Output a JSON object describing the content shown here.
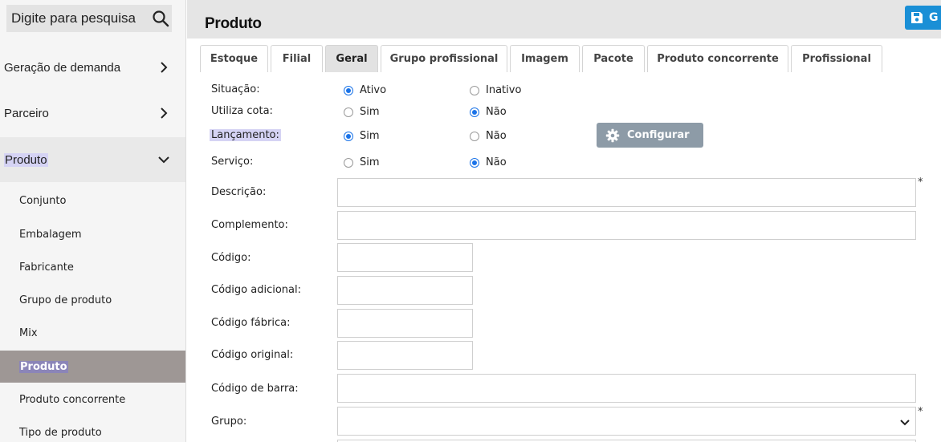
{
  "sidebar": {
    "search": {
      "placeholder": "Digite para pesquisa"
    },
    "groups": [
      {
        "label": "Geração de demanda"
      },
      {
        "label": "Parceiro"
      },
      {
        "label": "Produto"
      }
    ],
    "sub_items": [
      {
        "label": "Conjunto"
      },
      {
        "label": "Embalagem"
      },
      {
        "label": "Fabricante"
      },
      {
        "label": "Grupo de produto"
      },
      {
        "label": "Mix"
      },
      {
        "label": "Produto"
      },
      {
        "label": "Produto concorrente"
      },
      {
        "label": "Tipo de produto"
      }
    ]
  },
  "header": {
    "title": "Produto",
    "save_label": "G"
  },
  "tabs": [
    {
      "label": "Estoque"
    },
    {
      "label": "Filial"
    },
    {
      "label": "Geral"
    },
    {
      "label": "Grupo profissional"
    },
    {
      "label": "Imagem"
    },
    {
      "label": "Pacote"
    },
    {
      "label": "Produto concorrente"
    },
    {
      "label": "Profissional"
    }
  ],
  "form": {
    "situacao": {
      "label": "Situação:",
      "opt1": "Ativo",
      "opt2": "Inativo",
      "selected": "Ativo"
    },
    "utiliza_cota": {
      "label": "Utiliza cota:",
      "opt1": "Sim",
      "opt2": "Não",
      "selected": "Não"
    },
    "lancamento": {
      "label": "Lançamento:",
      "opt1": "Sim",
      "opt2": "Não",
      "selected": "Sim"
    },
    "servico": {
      "label": "Serviço:",
      "opt1": "Sim",
      "opt2": "Não",
      "selected": "Não"
    },
    "configurar_label": "Configurar",
    "descricao": {
      "label": "Descrição:",
      "value": ""
    },
    "complemento": {
      "label": "Complemento:",
      "value": ""
    },
    "codigo": {
      "label": "Código:",
      "value": ""
    },
    "codigo_adicional": {
      "label": "Código adicional:",
      "value": ""
    },
    "codigo_fabrica": {
      "label": "Código fábrica:",
      "value": ""
    },
    "codigo_original": {
      "label": "Código original:",
      "value": ""
    },
    "codigo_barra": {
      "label": "Código de barra:",
      "value": ""
    },
    "grupo": {
      "label": "Grupo:",
      "value": ""
    },
    "required_mark": "*"
  },
  "colors": {
    "accent": "#1a8fd6",
    "radio": "#1a73e8",
    "config_button": "#8d9ba7",
    "active_menu": "#9e9795",
    "highlight": "#d5d3f4"
  }
}
